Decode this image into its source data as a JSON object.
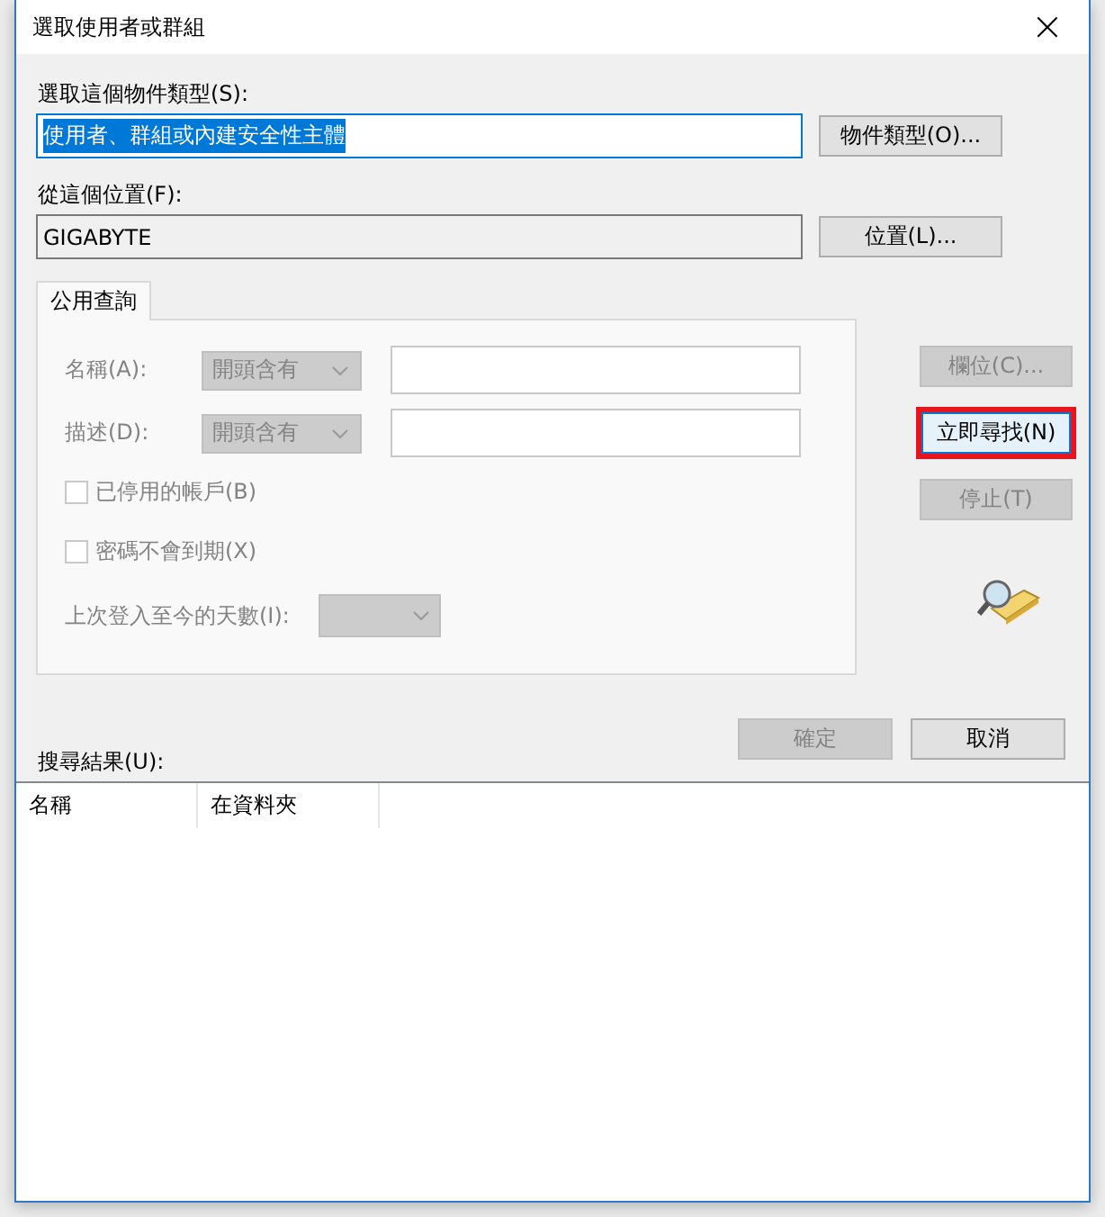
{
  "window": {
    "title": "選取使用者或群組",
    "close": "×"
  },
  "object_type": {
    "label": "選取這個物件類型(S):",
    "value": "使用者、群組或內建安全性主體",
    "value_selected": true,
    "button": "物件類型(O)..."
  },
  "location": {
    "label": "從這個位置(F):",
    "value": "GIGABYTE",
    "button": "位置(L)..."
  },
  "tabs": [
    {
      "label": "公用查詢",
      "selected": true
    }
  ],
  "query": {
    "rows": [
      {
        "label": "名稱(A):",
        "dropdown": "開頭含有"
      },
      {
        "label": "描述(D):",
        "dropdown": "開頭含有"
      }
    ],
    "checkboxes": [
      {
        "label": "已停用的帳戶(B)",
        "checked": false,
        "disabled": true
      },
      {
        "label": "密碼不會到期(X)",
        "checked": false,
        "disabled": true
      }
    ],
    "days_label": "上次登入至今的天數(I):"
  },
  "side_buttons": [
    {
      "label": "欄位(C)...",
      "disabled": true,
      "highlighted": false
    },
    {
      "label": "立即尋找(N)",
      "disabled": false,
      "highlighted": true
    },
    {
      "label": "停止(T)",
      "disabled": true,
      "highlighted": false
    }
  ],
  "footer_buttons": [
    {
      "label": "確定",
      "disabled": true
    },
    {
      "label": "取消",
      "disabled": false
    }
  ],
  "results": {
    "label": "搜尋結果(U):",
    "columns": [
      "名稱",
      "在資料夾"
    ]
  }
}
